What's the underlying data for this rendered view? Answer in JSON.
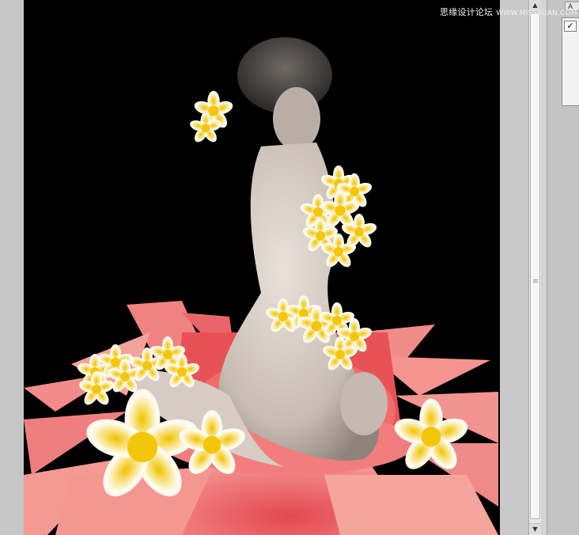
{
  "watermark": {
    "text": "思缘设计论坛",
    "url": "WWW.MISSYUAN.COM"
  },
  "panel": {
    "tab_label": "A",
    "checkbox_mark": "✓"
  },
  "scrollbar": {
    "up_arrow": "▲",
    "down_arrow": "▼",
    "grip": "≡"
  },
  "canvas": {
    "background": "#000000",
    "subject": "photo-composite-woman-with-frangipani-flowers"
  },
  "colors": {
    "petal_pink": "#f08a8a",
    "flower_white": "#fffdf4",
    "flower_yellow": "#f6d21a",
    "skin": "#d9cfc6"
  }
}
